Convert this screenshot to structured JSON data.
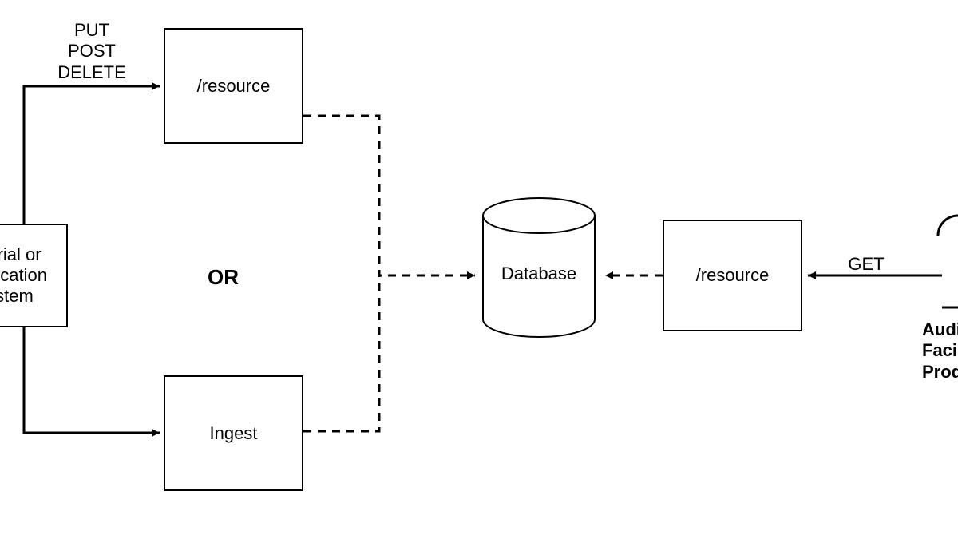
{
  "nodes": {
    "editorial_system": "itorial or\nublication\nystem",
    "resource_in": "/resource",
    "ingest": "Ingest",
    "database": "Database",
    "resource_out": "/resource",
    "audience": "Audience\nFacing\nProduct"
  },
  "edges": {
    "put_post_delete": "PUT\nPOST\nDELETE",
    "get": "GET",
    "or": "OR"
  }
}
